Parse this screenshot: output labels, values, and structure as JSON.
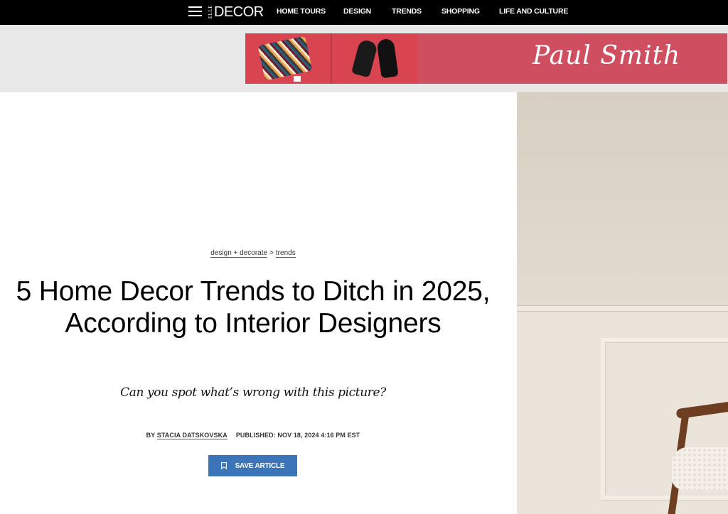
{
  "nav": {
    "logo_small": "ELLE",
    "logo_main": "DECOR",
    "links": [
      "HOME TOURS",
      "DESIGN",
      "TRENDS",
      "SHOPPING",
      "LIFE AND CULTURE"
    ],
    "menu_icon": "hamburger-menu-icon"
  },
  "ad": {
    "brand": "Paul Smith",
    "background_color": "#cf4f61"
  },
  "article": {
    "breadcrumb": {
      "parent": "design + decorate",
      "separator": ">",
      "child": "trends"
    },
    "headline": "5 Home Decor Trends to Ditch in 2025, According to Interior Designers",
    "dek": "Can you spot what’s wrong with this picture?",
    "byline": {
      "prefix": "BY",
      "author": "STACIA DATSKOVSKA",
      "published": "PUBLISHED: NOV 18, 2024 4:16 PM EST"
    },
    "save_button": {
      "label": "SAVE ARTICLE",
      "icon": "bookmark-icon",
      "color": "#3b74b8"
    }
  }
}
